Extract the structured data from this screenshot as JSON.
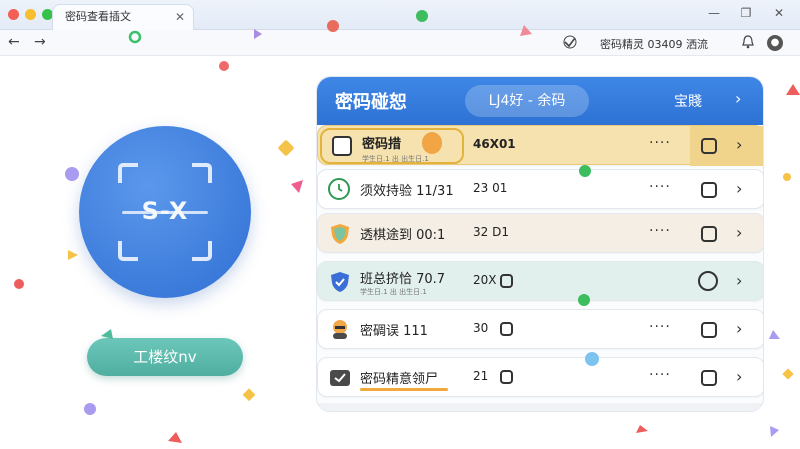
{
  "window": {
    "tab_title": "密码查看插文",
    "tab_close": "✕",
    "minimize": "—",
    "maximize": "❐",
    "close": "✕"
  },
  "toolbar": {
    "back": "←",
    "forward": "→",
    "extension_icon": "extension-icon",
    "address_text": "密码精灵 03409 洒流",
    "bell_icon": "bell-icon",
    "avatar_icon": "avatar-icon"
  },
  "hero": {
    "scan_text": "S-X",
    "action_button": "工楼纹nv"
  },
  "panel": {
    "header": {
      "title": "密码碰恕",
      "pill": "LJ4好 - 余码",
      "right_label": "宝賤",
      "chevron": "›"
    },
    "rows": [
      {
        "name": "密码措",
        "code": "46X01",
        "sub": "学生日.1 出 出生日.1",
        "dots": "····",
        "chevron": "›",
        "icon": "square-outline-icon"
      },
      {
        "name": "须效持验 11/31",
        "code": "23  01",
        "dots": "····",
        "chevron": "›",
        "icon": "clock-icon"
      },
      {
        "name": "透棋途到 00:1",
        "code": "32  D1",
        "dots": "····",
        "chevron": "›",
        "icon": "shield-icon"
      },
      {
        "name": "班总挤恰 70.7",
        "code": "20X",
        "sub": "学生日.1 出 出生日.1",
        "chevron": "›",
        "icon": "shield-check-icon"
      },
      {
        "name": "密碉误 111",
        "code": "30",
        "dots": "····",
        "chevron": "›",
        "icon": "avatar-icon"
      },
      {
        "name": "密码精意领尸",
        "code": "21",
        "dots": "····",
        "chevron": "›",
        "icon": "checkbox-icon"
      }
    ]
  },
  "colors": {
    "header_blue": "#2f75d8",
    "circle_blue": "#3d7fe0",
    "button_teal": "#58b6a8",
    "row_highlight_yellow": "#f6e3b0",
    "row_beige": "#f3ede3",
    "row_teal_tint": "#e3f1ee",
    "row_grey": "#f4f5f7"
  }
}
